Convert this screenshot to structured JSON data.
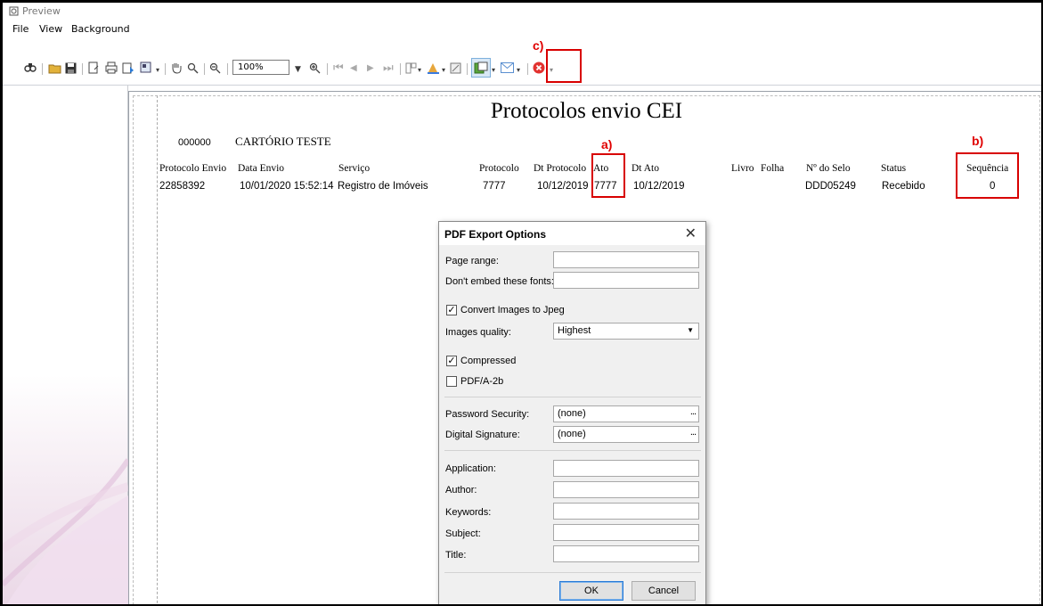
{
  "window": {
    "title": "Preview"
  },
  "menu": [
    "File",
    "View",
    "Background"
  ],
  "toolbar": {
    "zoom": "100%"
  },
  "annotations": {
    "a": "a)",
    "b": "b)",
    "c": "c)"
  },
  "report": {
    "title": "Protocolos envio CEI",
    "office_code": "000000",
    "office_name": "CARTÓRIO TESTE",
    "columns": {
      "protocolo_envio": "Protocolo Envio",
      "data_envio": "Data Envio",
      "servico": "Serviço",
      "protocolo": "Protocolo",
      "dt_protocolo": "Dt Protocolo",
      "ato": "Ato",
      "dt_ato": "Dt Ato",
      "livro": "Livro",
      "folha": "Folha",
      "selo": "Nº do Selo",
      "status": "Status",
      "sequencia": "Sequência"
    },
    "row": {
      "protocolo_envio": "22858392",
      "data_envio": "10/01/2020 15:52:14",
      "servico": "Registro de Imóveis",
      "protocolo": "7777",
      "dt_protocolo": "10/12/2019",
      "ato": "7777",
      "dt_ato": "10/12/2019",
      "livro": "",
      "folha": "",
      "selo": "DDD05249",
      "status": "Recebido",
      "sequencia": "0"
    }
  },
  "dialog": {
    "title": "PDF Export Options",
    "page_range_label": "Page range:",
    "page_range_value": "",
    "dont_embed_label": "Don't embed these fonts:",
    "dont_embed_value": "",
    "convert_images_label": "Convert Images to Jpeg",
    "convert_images_checked": true,
    "images_quality_label": "Images quality:",
    "images_quality_value": "Highest",
    "compressed_label": "Compressed",
    "compressed_checked": true,
    "pdfa_label": "PDF/A-2b",
    "pdfa_checked": false,
    "password_label": "Password Security:",
    "password_value": "(none)",
    "signature_label": "Digital Signature:",
    "signature_value": "(none)",
    "application_label": "Application:",
    "author_label": "Author:",
    "keywords_label": "Keywords:",
    "subject_label": "Subject:",
    "title_label": "Title:",
    "ok_label": "OK",
    "cancel_label": "Cancel",
    "ellipsis": "...",
    "close_glyph": "✕"
  },
  "colors": {
    "annotation": "#d80000",
    "dialog_bg": "#f0f0f0",
    "ok_border": "#2b7bd6"
  }
}
